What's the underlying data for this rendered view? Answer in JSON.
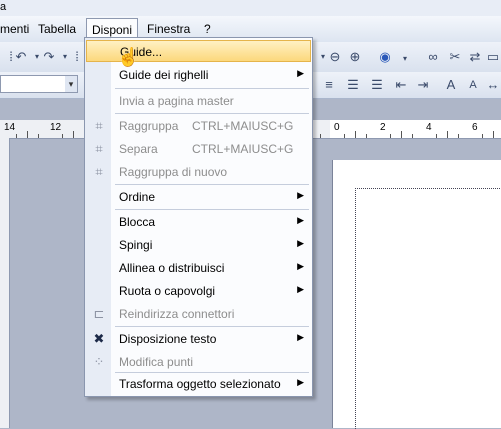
{
  "title": {
    "fragment": "a"
  },
  "menubar": {
    "items": [
      "menti",
      "Tabella",
      "Disponi",
      "Finestra",
      "?"
    ],
    "active": "Disponi"
  },
  "ruler": {
    "labels": [
      "14",
      "12",
      "0",
      "2",
      "4",
      "6"
    ]
  },
  "menu": {
    "items": [
      {
        "label": "Guide...",
        "shortcut": "",
        "submenu": false,
        "enabled": true,
        "highlighted": true,
        "icon": ""
      },
      {
        "label": "Guide dei righelli",
        "shortcut": "",
        "submenu": true,
        "enabled": true,
        "icon": ""
      },
      {
        "label": "Invia a pagina master",
        "shortcut": "",
        "submenu": false,
        "enabled": false,
        "icon": ""
      },
      {
        "label": "Raggruppa",
        "shortcut": "CTRL+MAIUSC+G",
        "submenu": false,
        "enabled": false,
        "icon": "group-icon"
      },
      {
        "label": "Separa",
        "shortcut": "CTRL+MAIUSC+G",
        "submenu": false,
        "enabled": false,
        "icon": "ungroup-icon"
      },
      {
        "label": "Raggruppa di nuovo",
        "shortcut": "",
        "submenu": false,
        "enabled": false,
        "icon": "regroup-icon"
      },
      {
        "label": "Ordine",
        "shortcut": "",
        "submenu": true,
        "enabled": true,
        "icon": ""
      },
      {
        "label": "Blocca",
        "shortcut": "",
        "submenu": true,
        "enabled": true,
        "icon": ""
      },
      {
        "label": "Spingi",
        "shortcut": "",
        "submenu": true,
        "enabled": true,
        "icon": ""
      },
      {
        "label": "Allinea o distribuisci",
        "shortcut": "",
        "submenu": true,
        "enabled": true,
        "icon": ""
      },
      {
        "label": "Ruota o capovolgi",
        "shortcut": "",
        "submenu": true,
        "enabled": true,
        "icon": ""
      },
      {
        "label": "Reindirizza connettori",
        "shortcut": "",
        "submenu": false,
        "enabled": false,
        "icon": "reroute-connector-icon"
      },
      {
        "label": "Disposizione testo",
        "shortcut": "",
        "submenu": true,
        "enabled": true,
        "icon": "text-wrap-icon"
      },
      {
        "label": "Modifica punti",
        "shortcut": "",
        "submenu": false,
        "enabled": false,
        "icon": "edit-points-icon"
      },
      {
        "label": "Trasforma oggetto selezionato",
        "shortcut": "",
        "submenu": true,
        "enabled": true,
        "icon": ""
      }
    ]
  },
  "colors": {
    "highlight": "#fcd87c",
    "workspace": "#aeb6c8",
    "menu_bg": "#fbfcfe"
  }
}
